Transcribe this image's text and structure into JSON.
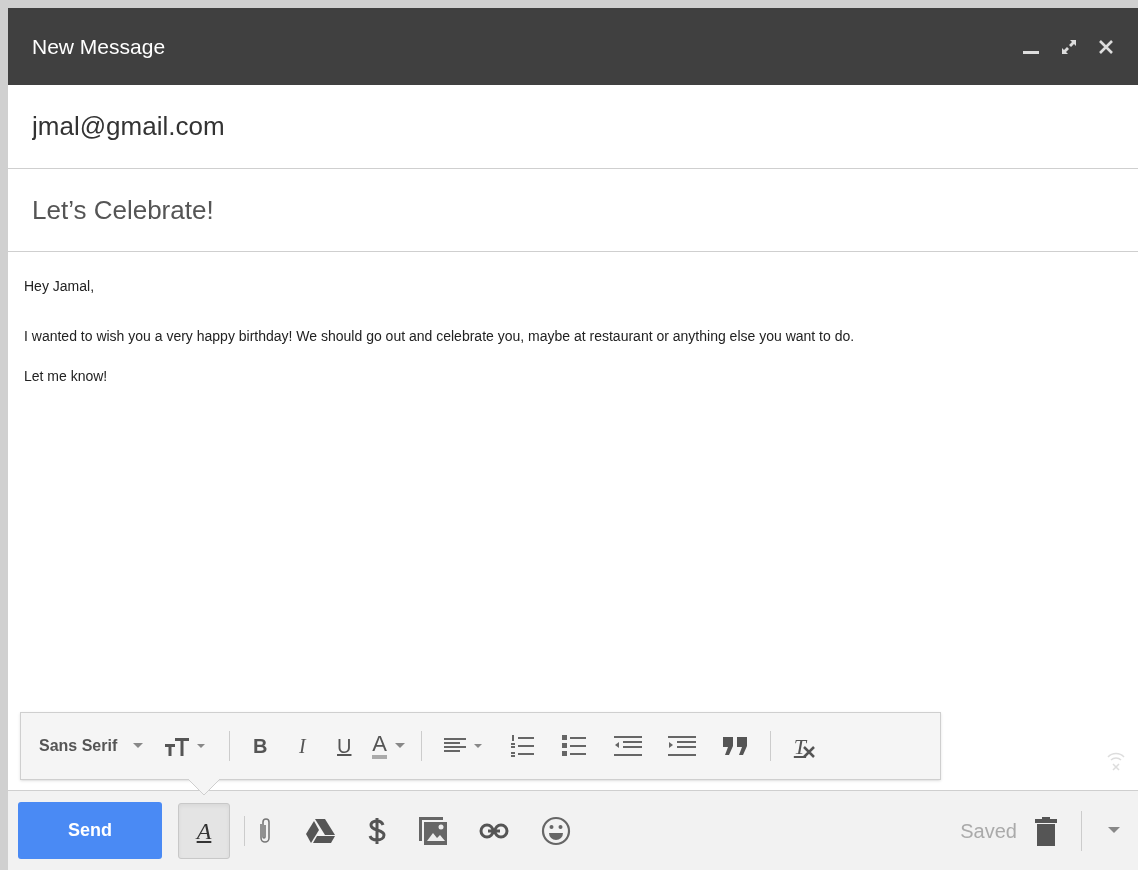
{
  "window": {
    "title": "New Message"
  },
  "to": {
    "value": "jmal@gmail.com"
  },
  "subject": {
    "value": "Let’s Celebrate!"
  },
  "body": [
    "Hey Jamal,",
    "I wanted to wish you a very happy birthday! We should go out and celebrate you, maybe at restaurant or anything else you want to do.",
    "Let me know!"
  ],
  "format_toolbar": {
    "font": "Sans Serif",
    "items": [
      {
        "kind": "size"
      },
      {
        "kind": "sep"
      },
      {
        "kind": "bold",
        "text": "B"
      },
      {
        "kind": "italic",
        "text": "I"
      },
      {
        "kind": "underline",
        "text": "U"
      },
      {
        "kind": "color"
      },
      {
        "kind": "sep"
      },
      {
        "kind": "align"
      },
      {
        "kind": "numbered"
      },
      {
        "kind": "bulleted"
      },
      {
        "kind": "outdent"
      },
      {
        "kind": "indent"
      },
      {
        "kind": "quote"
      },
      {
        "kind": "sep"
      },
      {
        "kind": "clear"
      }
    ],
    "color_glyph": "A",
    "clear_glyph": "T"
  },
  "bottom_bar": {
    "send": "Send",
    "formatting": {
      "glyph": "A",
      "selected": true
    },
    "tools": [
      {
        "kind": "attach"
      },
      {
        "kind": "drive"
      },
      {
        "kind": "money"
      },
      {
        "kind": "photo"
      },
      {
        "kind": "link"
      },
      {
        "kind": "emoji"
      }
    ],
    "status": "Saved"
  }
}
